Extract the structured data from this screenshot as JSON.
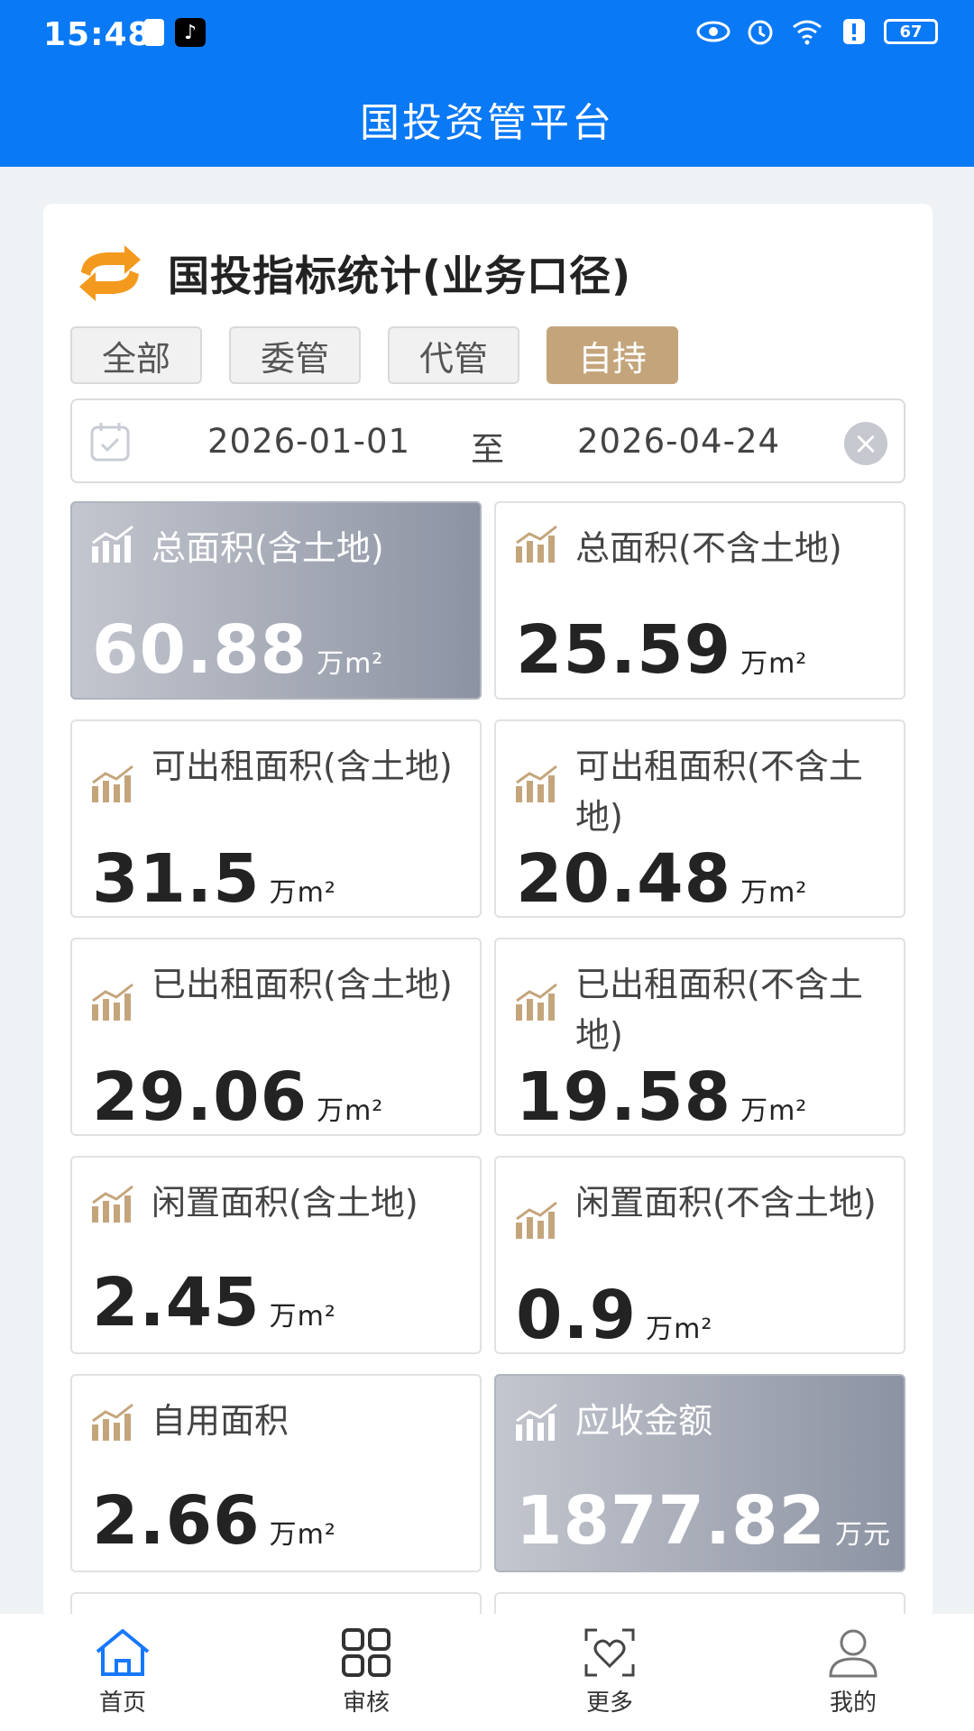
{
  "status_bar": {
    "time": "15:48",
    "battery": "67",
    "icons": [
      "battery-saver-icon",
      "tiktok-icon",
      "eye-icon",
      "alarm-icon",
      "wifi-icon",
      "alert-icon",
      "battery-icon"
    ]
  },
  "header": {
    "title": "国投资管平台"
  },
  "card": {
    "title": "国投指标统计(业务口径)",
    "tabs": [
      {
        "label": "全部",
        "active": false
      },
      {
        "label": "委管",
        "active": false
      },
      {
        "label": "代管",
        "active": false
      },
      {
        "label": "自持",
        "active": true
      }
    ],
    "date_range": {
      "start": "2026-01-01",
      "separator": "至",
      "end": "2026-04-24"
    }
  },
  "stats": [
    {
      "label": "总面积(含土地)",
      "value": "60.88",
      "unit": "万m²",
      "highlight": true
    },
    {
      "label": "总面积(不含土地)",
      "value": "25.59",
      "unit": "万m²",
      "highlight": false
    },
    {
      "label": "可出租面积(含土地)",
      "value": "31.5",
      "unit": "万m²",
      "highlight": false
    },
    {
      "label": "可出租面积(不含土地)",
      "value": "20.48",
      "unit": "万m²",
      "highlight": false
    },
    {
      "label": "已出租面积(含土地)",
      "value": "29.06",
      "unit": "万m²",
      "highlight": false
    },
    {
      "label": "已出租面积(不含土地)",
      "value": "19.58",
      "unit": "万m²",
      "highlight": false
    },
    {
      "label": "闲置面积(含土地)",
      "value": "2.45",
      "unit": "万m²",
      "highlight": false
    },
    {
      "label": "闲置面积(不含土地)",
      "value": "0.9",
      "unit": "万m²",
      "highlight": false
    },
    {
      "label": "自用面积",
      "value": "2.66",
      "unit": "万m²",
      "highlight": false
    },
    {
      "label": "应收金额",
      "value": "1877.82",
      "unit": "万元",
      "highlight": true
    }
  ],
  "bottom_nav": [
    {
      "label": "首页",
      "icon": "home-icon",
      "active": true
    },
    {
      "label": "审核",
      "icon": "grid-icon",
      "active": false
    },
    {
      "label": "更多",
      "icon": "heart-frame-icon",
      "active": false
    },
    {
      "label": "我的",
      "icon": "user-icon",
      "active": false
    }
  ],
  "colors": {
    "header": "#0a79f5",
    "accent_gold": "#c4a57b",
    "home_active": "#1677ff"
  }
}
